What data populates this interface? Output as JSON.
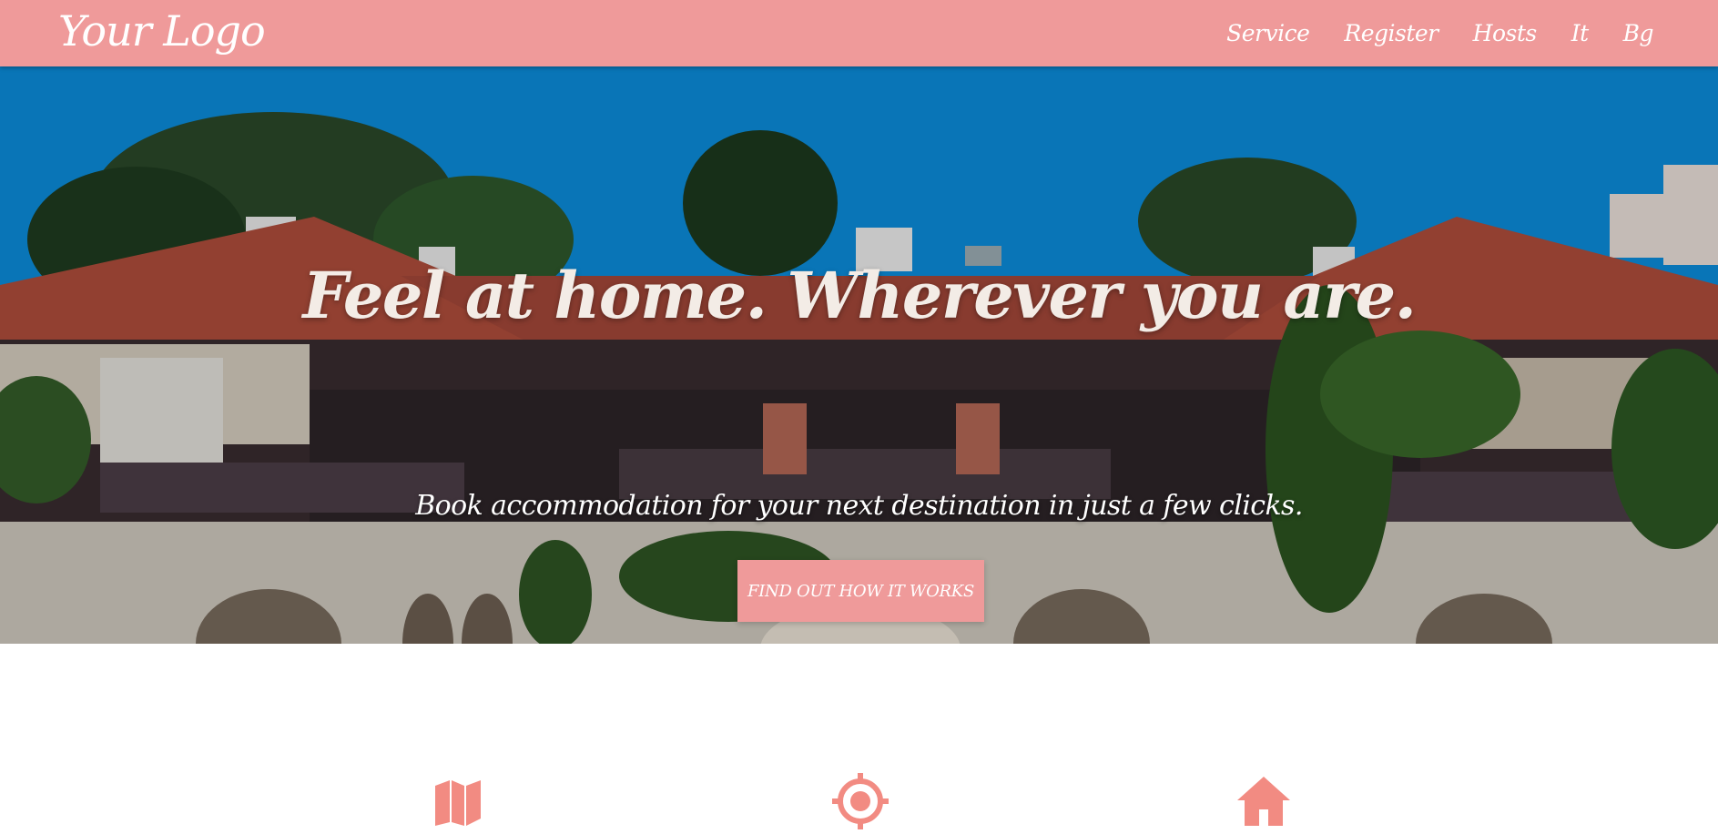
{
  "header": {
    "logo": "Your Logo",
    "nav": [
      {
        "label": "Service"
      },
      {
        "label": "Register"
      },
      {
        "label": "Hosts"
      },
      {
        "label": "It"
      },
      {
        "label": "Bg"
      }
    ]
  },
  "hero": {
    "title": "Feel at home. Wherever you are.",
    "subtitle": "Book accommodation for your next destination in just a few clicks.",
    "cta_label": "FIND OUT HOW IT WORKS"
  },
  "features": {
    "icons": [
      "map-icon",
      "crosshair-icon",
      "home-icon"
    ]
  },
  "colors": {
    "accent": "#ef9a9a",
    "icon": "#f28b82"
  }
}
